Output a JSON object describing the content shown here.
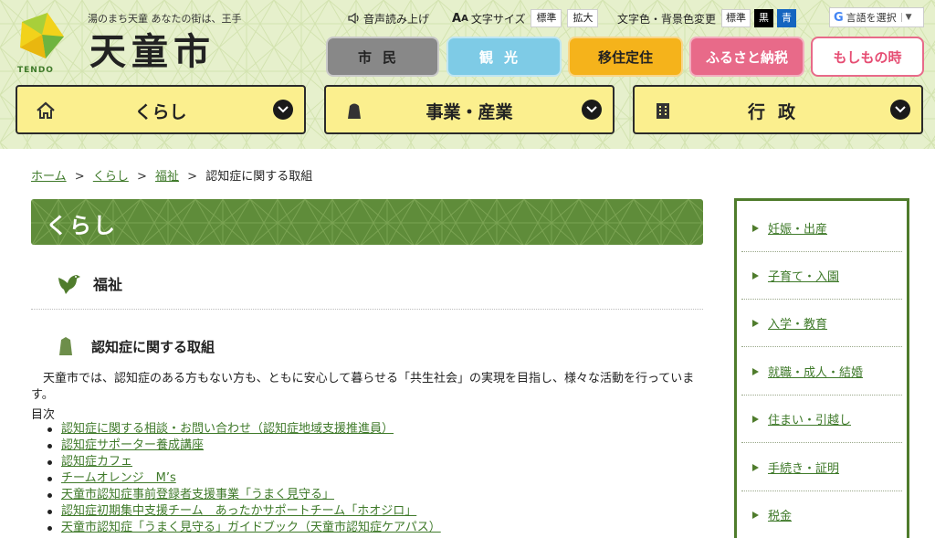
{
  "header": {
    "logo": {
      "catchphrase": "湯のまち天童 あなたの街は、王手",
      "city_name": "天童市",
      "brand": "TENDO"
    },
    "utility": {
      "voice_label": "音声読み上げ",
      "font_size_label": "文字サイズ",
      "font_size_standard": "標準",
      "font_size_large": "拡大",
      "color_label": "文字色・背景色変更",
      "color_standard": "標準",
      "color_black": "黒",
      "color_blue": "青",
      "language_label": "言語を選択"
    },
    "category_buttons": [
      {
        "label": "市民",
        "color": "#888888"
      },
      {
        "label": "観光",
        "color": "#7ecbe6"
      },
      {
        "label": "移住定住",
        "color": "#f5b31b"
      },
      {
        "label": "ふるさと納税",
        "color": "#e86a89"
      },
      {
        "label": "もしもの時",
        "color": "#ffffff"
      }
    ],
    "main_nav": [
      {
        "label": "くらし",
        "icon": "house-icon"
      },
      {
        "label": "事業・産業",
        "icon": "bell-icon"
      },
      {
        "label": "行政",
        "icon": "building-icon"
      }
    ]
  },
  "breadcrumb": {
    "home": "ホーム",
    "living": "くらし",
    "welfare": "福祉",
    "current": "認知症に関する取組",
    "separator": ">"
  },
  "main": {
    "banner_title": "くらし",
    "section_heading": "福祉",
    "page_heading": "認知症に関する取組",
    "intro": "天童市では、認知症のある方もない方も、ともに安心して暮らせる「共生社会」の実現を目指し、様々な活動を行っています。",
    "toc_title": "目次",
    "toc_items": [
      "認知症に関する相談・お問い合わせ（認知症地域支援推進員）",
      "認知症サポーター養成講座",
      "認知症カフェ",
      "チームオレンジ　M’s",
      "天童市認知症事前登録者支援事業「うまく見守る」",
      "認知症初期集中支援チーム　あったかサポートチーム「ホオジロ」",
      "天童市認知症「うまく見守る」ガイドブック（天童市認知症ケアパス）"
    ]
  },
  "sidebar": {
    "items": [
      "妊娠・出産",
      "子育て・入園",
      "入学・教育",
      "就職・成人・結婚",
      "住まい・引越し",
      "手続き・証明",
      "税金"
    ]
  },
  "colors": {
    "header_bg": "#e6f0cc",
    "nav_yellow": "#fbef8e",
    "banner_green": "#5f8c3a",
    "link_green": "#3f7a2a",
    "sidebar_border": "#4f7c2c"
  }
}
